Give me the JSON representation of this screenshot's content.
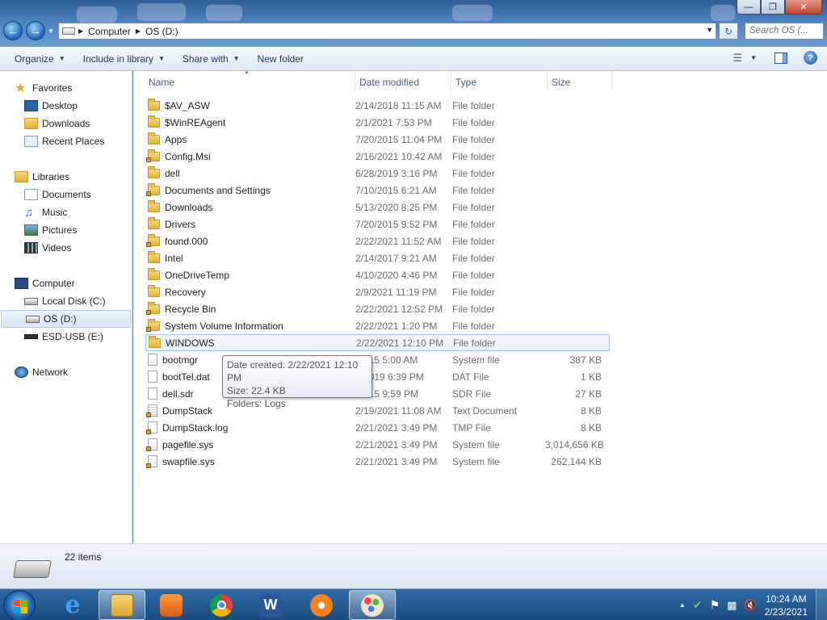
{
  "window": {
    "minimize_glyph": "—",
    "maximize_glyph": "❐",
    "close_glyph": "✕"
  },
  "address": {
    "crumbs": [
      "Computer",
      "OS (D:)"
    ],
    "search_placeholder": "Search OS (..."
  },
  "toolbar": {
    "organize": "Organize",
    "include": "Include in library",
    "share": "Share with",
    "new_folder": "New folder",
    "help": "?"
  },
  "sidebar": {
    "favorites": "Favorites",
    "fav_items": [
      "Desktop",
      "Downloads",
      "Recent Places"
    ],
    "libraries": "Libraries",
    "lib_items": [
      "Documents",
      "Music",
      "Pictures",
      "Videos"
    ],
    "computer": "Computer",
    "comp_items": [
      "Local Disk (C:)",
      "OS (D:)",
      "ESD-USB (E:)"
    ],
    "network": "Network"
  },
  "columns": {
    "name": "Name",
    "date": "Date modified",
    "type": "Type",
    "size": "Size"
  },
  "files": [
    {
      "name": "$AV_ASW",
      "date": "2/14/2018 11:15 AM",
      "type": "File folder",
      "size": "",
      "icon": "folder"
    },
    {
      "name": "$WinREAgent",
      "date": "2/1/2021 7:53 PM",
      "type": "File folder",
      "size": "",
      "icon": "folder"
    },
    {
      "name": "Apps",
      "date": "7/20/2015 11:04 PM",
      "type": "File folder",
      "size": "",
      "icon": "folder"
    },
    {
      "name": "Config.Msi",
      "date": "2/16/2021 10:42 AM",
      "type": "File folder",
      "size": "",
      "icon": "folder-locked"
    },
    {
      "name": "dell",
      "date": "6/28/2019 3:16 PM",
      "type": "File folder",
      "size": "",
      "icon": "folder"
    },
    {
      "name": "Documents and Settings",
      "date": "7/10/2015 6:21 AM",
      "type": "File folder",
      "size": "",
      "icon": "folder-locked"
    },
    {
      "name": "Downloads",
      "date": "5/13/2020 8:25 PM",
      "type": "File folder",
      "size": "",
      "icon": "folder"
    },
    {
      "name": "Drivers",
      "date": "7/20/2015 9:52 PM",
      "type": "File folder",
      "size": "",
      "icon": "folder"
    },
    {
      "name": "found.000",
      "date": "2/22/2021 11:52 AM",
      "type": "File folder",
      "size": "",
      "icon": "folder-locked"
    },
    {
      "name": "Intel",
      "date": "2/14/2017 9:21 AM",
      "type": "File folder",
      "size": "",
      "icon": "folder"
    },
    {
      "name": "OneDriveTemp",
      "date": "4/10/2020 4:46 PM",
      "type": "File folder",
      "size": "",
      "icon": "folder"
    },
    {
      "name": "Recovery",
      "date": "2/9/2021 11:19 PM",
      "type": "File folder",
      "size": "",
      "icon": "folder"
    },
    {
      "name": "Recycle Bin",
      "date": "2/22/2021 12:52 PM",
      "type": "File folder",
      "size": "",
      "icon": "folder-locked"
    },
    {
      "name": "System Volume Information",
      "date": "2/22/2021 1:20 PM",
      "type": "File folder",
      "size": "",
      "icon": "folder-locked"
    },
    {
      "name": "WINDOWS",
      "date": "2/22/2021 12:10 PM",
      "type": "File folder",
      "size": "",
      "icon": "folder"
    },
    {
      "name": "bootmgr",
      "date": "/2015 5:00 AM",
      "type": "System file",
      "size": "387 KB",
      "icon": "file-sys"
    },
    {
      "name": "bootTel.dat",
      "date": "3/2019 6:39 PM",
      "type": "DAT File",
      "size": "1 KB",
      "icon": "file"
    },
    {
      "name": "dell.sdr",
      "date": "/2015 9:59 PM",
      "type": "SDR File",
      "size": "27 KB",
      "icon": "file"
    },
    {
      "name": "DumpStack",
      "date": "2/19/2021 11:08 AM",
      "type": "Text Document",
      "size": "8 KB",
      "icon": "file-text-locked"
    },
    {
      "name": "DumpStack.log",
      "date": "2/21/2021 3:49 PM",
      "type": "TMP File",
      "size": "8 KB",
      "icon": "file-locked"
    },
    {
      "name": "pagefile.sys",
      "date": "2/21/2021 3:49 PM",
      "type": "System file",
      "size": "3,014,656 KB",
      "icon": "file-sys-locked"
    },
    {
      "name": "swapfile.sys",
      "date": "2/21/2021 3:49 PM",
      "type": "System file",
      "size": "262,144 KB",
      "icon": "file-sys-locked"
    }
  ],
  "tooltip": {
    "line1": "Date created: 2/22/2021 12:10 PM",
    "line2": "Size: 22.4 KB",
    "line3": "Folders: Logs"
  },
  "status": {
    "count": "22 items"
  },
  "taskbar": {
    "apps": [
      "internet-explorer-icon",
      "windows-explorer-icon",
      "media-player-icon",
      "chrome-icon",
      "word-icon",
      "avast-icon",
      "paint-icon"
    ],
    "time": "10:24 AM",
    "date": "2/23/2021"
  },
  "colors": {
    "accent": "#1b4c80",
    "selection": "#a3c3ea"
  }
}
